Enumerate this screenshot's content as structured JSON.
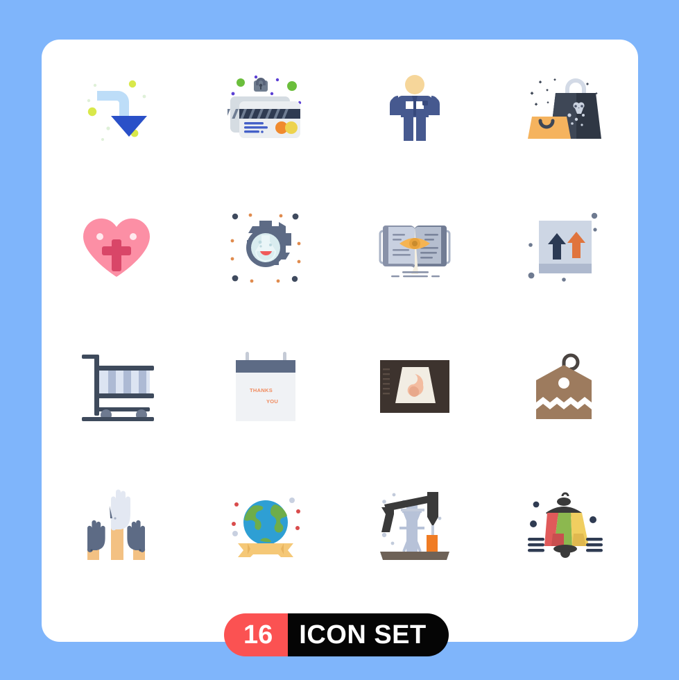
{
  "page": {
    "background_color": "#7FB5FB",
    "card_color": "#FFFFFF"
  },
  "banner": {
    "count": "16",
    "label": "ICON SET",
    "count_bg": "#FB5252",
    "label_bg": "#050505",
    "text_color": "#FFFFFF"
  },
  "grid": {
    "columns": 4,
    "rows": 4,
    "total": 16
  },
  "icons": [
    {
      "index": 1,
      "name": "turn-down-arrow-icon",
      "label": "Turn Down Arrow",
      "colors": [
        "#BDDDF8",
        "#2A50C8",
        "#D9E84A",
        "#E9F3C8"
      ]
    },
    {
      "index": 2,
      "name": "secure-credit-card-icon",
      "label": "Secure Credit Card",
      "colors": [
        "#DFE4EA",
        "#2F3B52",
        "#4460C8",
        "#F08A2E",
        "#EDD34E",
        "#6BBE3C",
        "#5B3FD4"
      ]
    },
    {
      "index": 3,
      "name": "businessman-avatar-icon",
      "label": "Businessman",
      "colors": [
        "#F6D69A",
        "#46598F",
        "#37497C"
      ]
    },
    {
      "index": 4,
      "name": "shopping-bags-icon",
      "label": "Shopping Bags",
      "colors": [
        "#3E4756",
        "#2F3744",
        "#F5B35E",
        "#D3DAE6"
      ]
    },
    {
      "index": 5,
      "name": "heart-cross-icon",
      "label": "Faith Heart",
      "colors": [
        "#FC8FA5",
        "#D94668",
        "#FFE9EE"
      ]
    },
    {
      "index": 6,
      "name": "gear-flask-research-icon",
      "label": "Research Settings",
      "colors": [
        "#5D6B85",
        "#D9ECEF",
        "#F05A5A",
        "#E08B4E",
        "#3F4A5E"
      ]
    },
    {
      "index": 7,
      "name": "book-eye-reading-icon",
      "label": "Reading Vision",
      "colors": [
        "#C8D0E0",
        "#8891A8",
        "#F5B452",
        "#E9A33D"
      ]
    },
    {
      "index": 8,
      "name": "upload-arrows-icon",
      "label": "Upload",
      "colors": [
        "#CDD6E4",
        "#2B3A54",
        "#E0743D",
        "#AEB9CE"
      ]
    },
    {
      "index": 9,
      "name": "luggage-trolley-icon",
      "label": "Luggage Trolley",
      "colors": [
        "#3E4A5C",
        "#ADBAD4",
        "#DCE4F2"
      ]
    },
    {
      "index": 10,
      "name": "thanks-calendar-icon",
      "label": "Thanks Calendar",
      "colors": [
        "#5D6B85",
        "#F0F2F5",
        "#F08A5D",
        "#C5CBD6"
      ],
      "text": {
        "line1": "THANKS",
        "line2": "YOU"
      }
    },
    {
      "index": 11,
      "name": "ultrasound-scan-icon",
      "label": "Ultrasound Scan",
      "colors": [
        "#3D332E",
        "#F2EDE3",
        "#F3BCA0",
        "#E8A88B"
      ]
    },
    {
      "index": 12,
      "name": "price-tag-icon",
      "label": "Price Tag",
      "colors": [
        "#9D7B5E",
        "#4A4441",
        "#FFFFFF"
      ]
    },
    {
      "index": 13,
      "name": "raised-gloved-hands-icon",
      "label": "Gloved Hands",
      "colors": [
        "#5D6B85",
        "#D7DCE8",
        "#F3C183",
        "#E9B270"
      ]
    },
    {
      "index": 14,
      "name": "globe-banner-icon",
      "label": "World Globe Ribbon",
      "colors": [
        "#2E9FD4",
        "#6EAD4A",
        "#F5C877",
        "#E8B45E",
        "#D94C4C",
        "#C8D0E0"
      ]
    },
    {
      "index": 15,
      "name": "oil-pump-jack-icon",
      "label": "Oil Pump Jack",
      "colors": [
        "#3A3A3A",
        "#B7C2D8",
        "#F07C24",
        "#6E6257",
        "#C2CBDB"
      ]
    },
    {
      "index": 16,
      "name": "street-lantern-icon",
      "label": "Street Lantern",
      "colors": [
        "#3A3A3A",
        "#E05A5A",
        "#8CB84F",
        "#F0CE60",
        "#2F3B52"
      ]
    }
  ]
}
